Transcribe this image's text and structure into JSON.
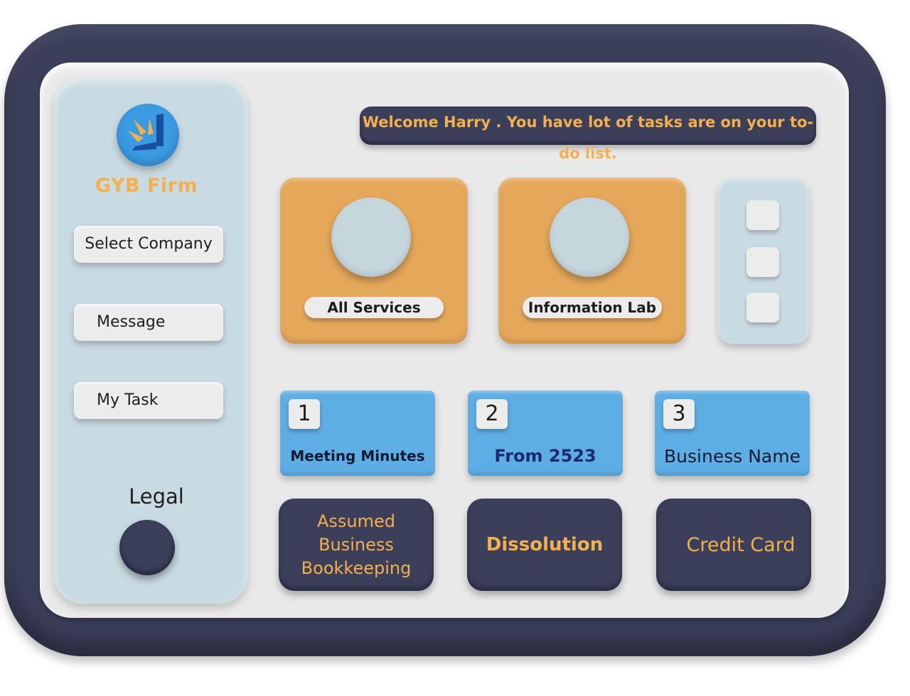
{
  "brand": {
    "name": "GYB Firm"
  },
  "sidebar": {
    "items": [
      {
        "label": "Select Company"
      },
      {
        "label": "Message"
      },
      {
        "label": "My Task"
      }
    ],
    "legal_label": "Legal"
  },
  "header": {
    "welcome_text": "Welcome Harry . You have lot of tasks are on your to-do list."
  },
  "cards": [
    {
      "label": "All Services"
    },
    {
      "label": "Information Lab"
    }
  ],
  "numbered_tiles": [
    {
      "number": "1",
      "label": "Meeting Minutes"
    },
    {
      "number": "2",
      "label": "From 2523"
    },
    {
      "number": "3",
      "label": "Business Name"
    }
  ],
  "action_tiles": [
    {
      "label": "Assumed Business Bookkeeping"
    },
    {
      "label": "Dissolution"
    },
    {
      "label": "Credit Card"
    }
  ],
  "colors": {
    "frame": "#3b3f5a",
    "accent_orange": "#f3b04c",
    "card_orange": "#e5a85a",
    "tile_blue": "#5eaee6",
    "panel_blue": "#c9dbe2"
  }
}
